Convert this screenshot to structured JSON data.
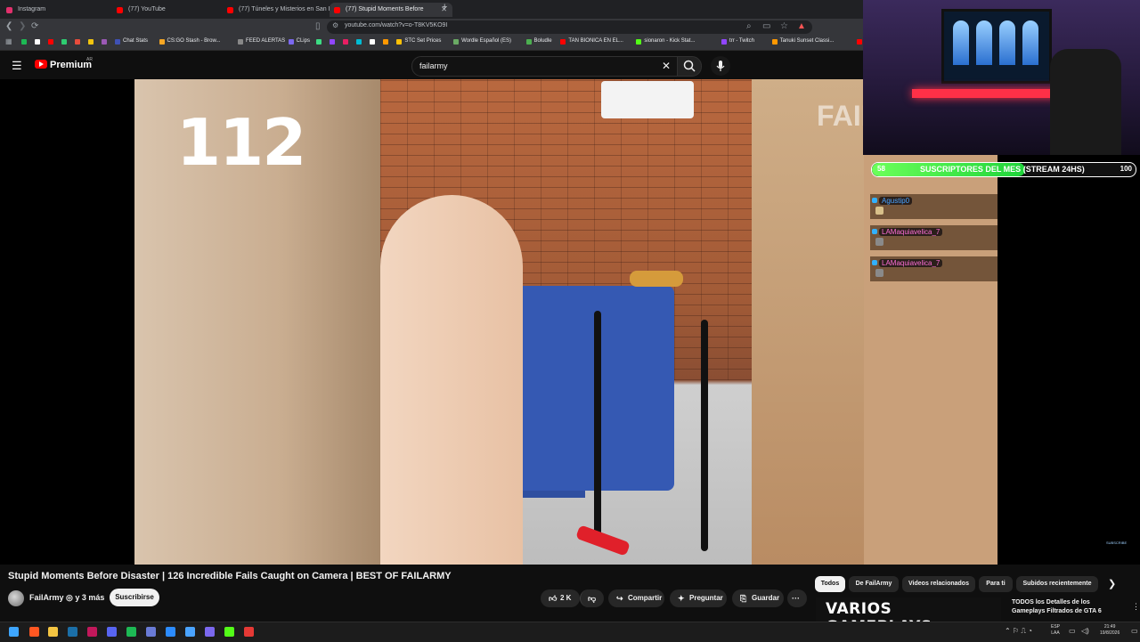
{
  "browser": {
    "tabs": [
      {
        "label": "Instagram",
        "color": "#e1306c"
      },
      {
        "label": "(77) YouTube",
        "color": "#ff0000"
      },
      {
        "label": "(77) Túneles y Misterios en San Isidr",
        "color": "#ff0000"
      },
      {
        "label": "(77) Stupid Moments Before",
        "color": "#ff0000",
        "active": true
      }
    ],
    "new_tab": "+",
    "url": "youtube.com/watch?v=o-T8KV5KO9I",
    "bookmarks": [
      {
        "label": "",
        "color": "#1db954"
      },
      {
        "label": "",
        "color": "#ffffff"
      },
      {
        "label": "",
        "color": "#ff0000"
      },
      {
        "label": "",
        "color": "#2ecc71"
      },
      {
        "label": "",
        "color": "#e74c3c"
      },
      {
        "label": "",
        "color": "#f1c40f"
      },
      {
        "label": "",
        "color": "#9b59b6"
      },
      {
        "label": "Chat Stats",
        "color": "#3f51b5"
      },
      {
        "label": "CS:GO Stash - Brow...",
        "color": "#f5a623"
      },
      {
        "label": "FEED ALERTAS",
        "color": "#888888"
      },
      {
        "label": "CLips",
        "color": "#7b68ee"
      },
      {
        "label": "",
        "color": "#3ddc84"
      },
      {
        "label": "",
        "color": "#9146ff"
      },
      {
        "label": "",
        "color": "#e91e63"
      },
      {
        "label": "",
        "color": "#00bcd4"
      },
      {
        "label": "",
        "color": "#ffffff"
      },
      {
        "label": "",
        "color": "#ff9800"
      },
      {
        "label": "STC Set Prices",
        "color": "#ffc107"
      },
      {
        "label": "Wordle Español (ES)",
        "color": "#6aaa64"
      },
      {
        "label": "Boludle",
        "color": "#4caf50"
      },
      {
        "label": "TAN BIONICA EN EL...",
        "color": "#ff0000"
      },
      {
        "label": "sionaron - Kick Stat...",
        "color": "#53fc18"
      },
      {
        "label": "trr - Twitch",
        "color": "#9146ff"
      },
      {
        "label": "Tanuki Sunset Classi...",
        "color": "#ff9800"
      },
      {
        "label": "(2)",
        "color": "#ff0000"
      }
    ]
  },
  "youtube": {
    "logo_text": "Premium",
    "country": "AR",
    "search_value": "failarmy",
    "video": {
      "overlay_number": "112",
      "watermark": "FAIL"
    },
    "title": "Stupid Moments Before Disaster | 126 Incredible Fails Caught on Camera | BEST OF FAILARMY",
    "channel": "FailArmy ◎ y 3 más",
    "subscribe": "Suscribirse",
    "actions": {
      "likes": "2 K",
      "share": "Compartir",
      "ask": "Preguntar",
      "save": "Guardar",
      "more": "···"
    },
    "chips": [
      "Todos",
      "De FailArmy",
      "Videos relacionados",
      "Para ti",
      "Subidos recientemente"
    ],
    "recommendation": {
      "thumb_text": "VARIOS GAMEPLAYS",
      "title": "TODOS los Detalles de los Gameplays Filtrados de GTA 6"
    }
  },
  "stream": {
    "sub_current": "58",
    "sub_title": "SUSCRIPTORES DEL MES (STREAM 24HS)",
    "sub_goal": "100",
    "sub_progress": 0.58,
    "chat": [
      {
        "user": "Agustip0",
        "color": "#4aa3ff"
      },
      {
        "user": "LAMaquiavelica_7",
        "color": "#ff6fd8"
      },
      {
        "user": "LAMaquiavelica_7",
        "color": "#ff6fd8"
      }
    ],
    "subscribe_mini": "SUBSCRIBE"
  },
  "taskbar": {
    "lang": [
      "ESP",
      "LAA"
    ],
    "time": "21:49",
    "date": "19/8/2026"
  }
}
